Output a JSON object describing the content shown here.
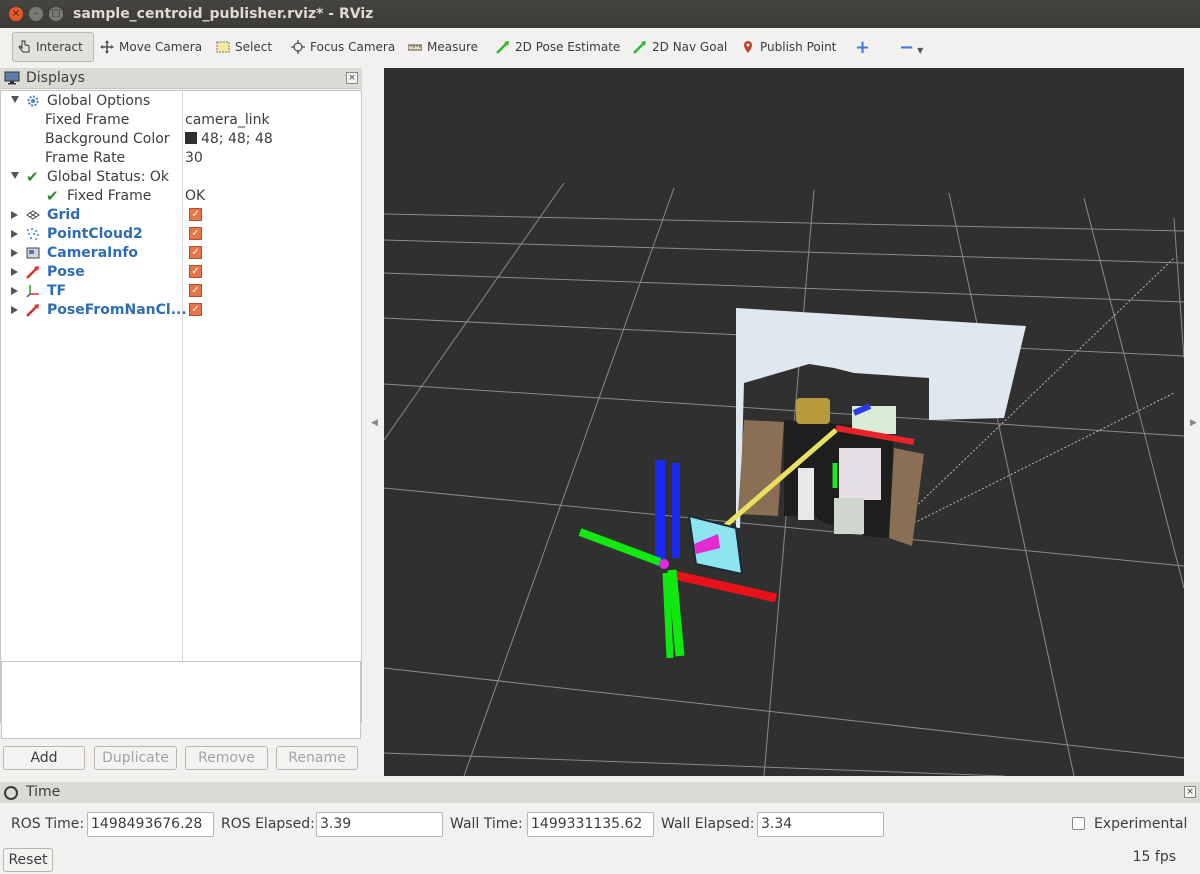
{
  "window": {
    "title": "sample_centroid_publisher.rviz* - RViz",
    "close": "×",
    "minimize": "–",
    "maximize": "□"
  },
  "toolbar": {
    "interact": "Interact",
    "move_camera": "Move Camera",
    "select": "Select",
    "focus_camera": "Focus Camera",
    "measure": "Measure",
    "pose_estimate": "2D Pose Estimate",
    "nav_goal": "2D Nav Goal",
    "publish_point": "Publish Point",
    "add_tool": "+",
    "remove_tool": "−"
  },
  "displays": {
    "title": "Displays",
    "rows": {
      "global_options": "Global Options",
      "fixed_frame_label": "Fixed Frame",
      "fixed_frame_value": "camera_link",
      "bg_color_label": "Background Color",
      "bg_color_value": "48; 48; 48",
      "frame_rate_label": "Frame Rate",
      "frame_rate_value": "30",
      "global_status": "Global Status: Ok",
      "status_fixed_frame": "Fixed Frame",
      "status_fixed_frame_value": "OK",
      "grid": "Grid",
      "pointcloud2": "PointCloud2",
      "camerainfo": "CameraInfo",
      "pose": "Pose",
      "tf": "TF",
      "pose_from_nan": "PoseFromNanCl..."
    },
    "bg_color_hex": "#303030",
    "buttons": {
      "add": "Add",
      "duplicate": "Duplicate",
      "remove": "Remove",
      "rename": "Rename"
    }
  },
  "time": {
    "title": "Time",
    "ros_time_label": "ROS Time:",
    "ros_time": "1498493676.28",
    "ros_elapsed_label": "ROS Elapsed:",
    "ros_elapsed": "3.39",
    "wall_time_label": "Wall Time:",
    "wall_time": "1499331135.62",
    "wall_elapsed_label": "Wall Elapsed:",
    "wall_elapsed": "3.34",
    "experimental_label": "Experimental"
  },
  "status": {
    "reset": "Reset",
    "fps": "15 fps"
  },
  "colors": {
    "accent_orange": "#e8744a",
    "link_blue": "#2e6db3",
    "viewport_bg": "#303030"
  }
}
